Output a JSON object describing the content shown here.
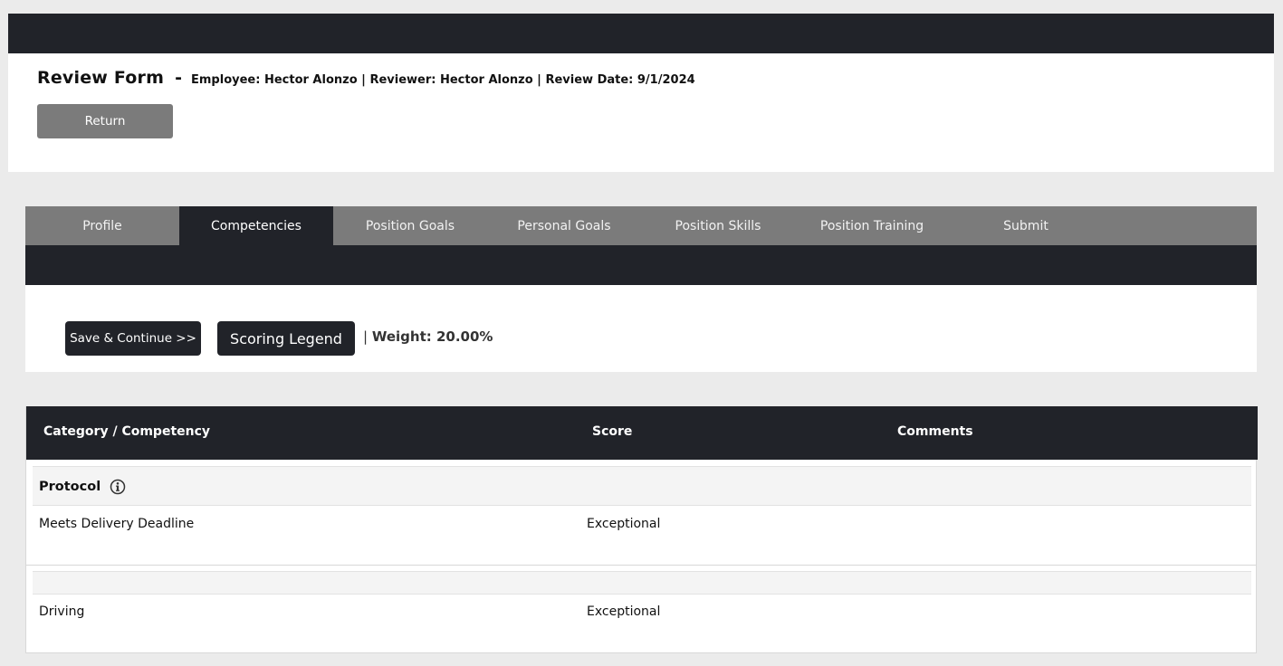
{
  "header": {
    "title": "Review Form",
    "separator": "-",
    "meta": "Employee: Hector Alonzo | Reviewer: Hector Alonzo | Review Date: 9/1/2024",
    "return_label": "Return"
  },
  "tabs": [
    {
      "label": "Profile",
      "active": false
    },
    {
      "label": "Competencies",
      "active": true
    },
    {
      "label": "Position Goals",
      "active": false
    },
    {
      "label": "Personal Goals",
      "active": false
    },
    {
      "label": "Position Skills",
      "active": false
    },
    {
      "label": "Position Training",
      "active": false
    },
    {
      "label": "Submit",
      "active": false
    }
  ],
  "toolbar": {
    "save_label": "Save & Continue >>",
    "legend_label": "Scoring Legend",
    "pipe": "|",
    "weight_text": "Weight: 20.00%"
  },
  "table": {
    "headers": {
      "category": "Category / Competency",
      "score": "Score",
      "comments": "Comments"
    },
    "category": {
      "name": "Protocol",
      "icon": "info-icon"
    },
    "rows": [
      {
        "name": "Meets Delivery Deadline",
        "score": "Exceptional",
        "comment": ""
      },
      {
        "name": "Driving",
        "score": "Exceptional",
        "comment": ""
      }
    ]
  },
  "colors": {
    "dark": "#212329",
    "gray": "#7b7b7b",
    "background": "#ebebeb"
  }
}
